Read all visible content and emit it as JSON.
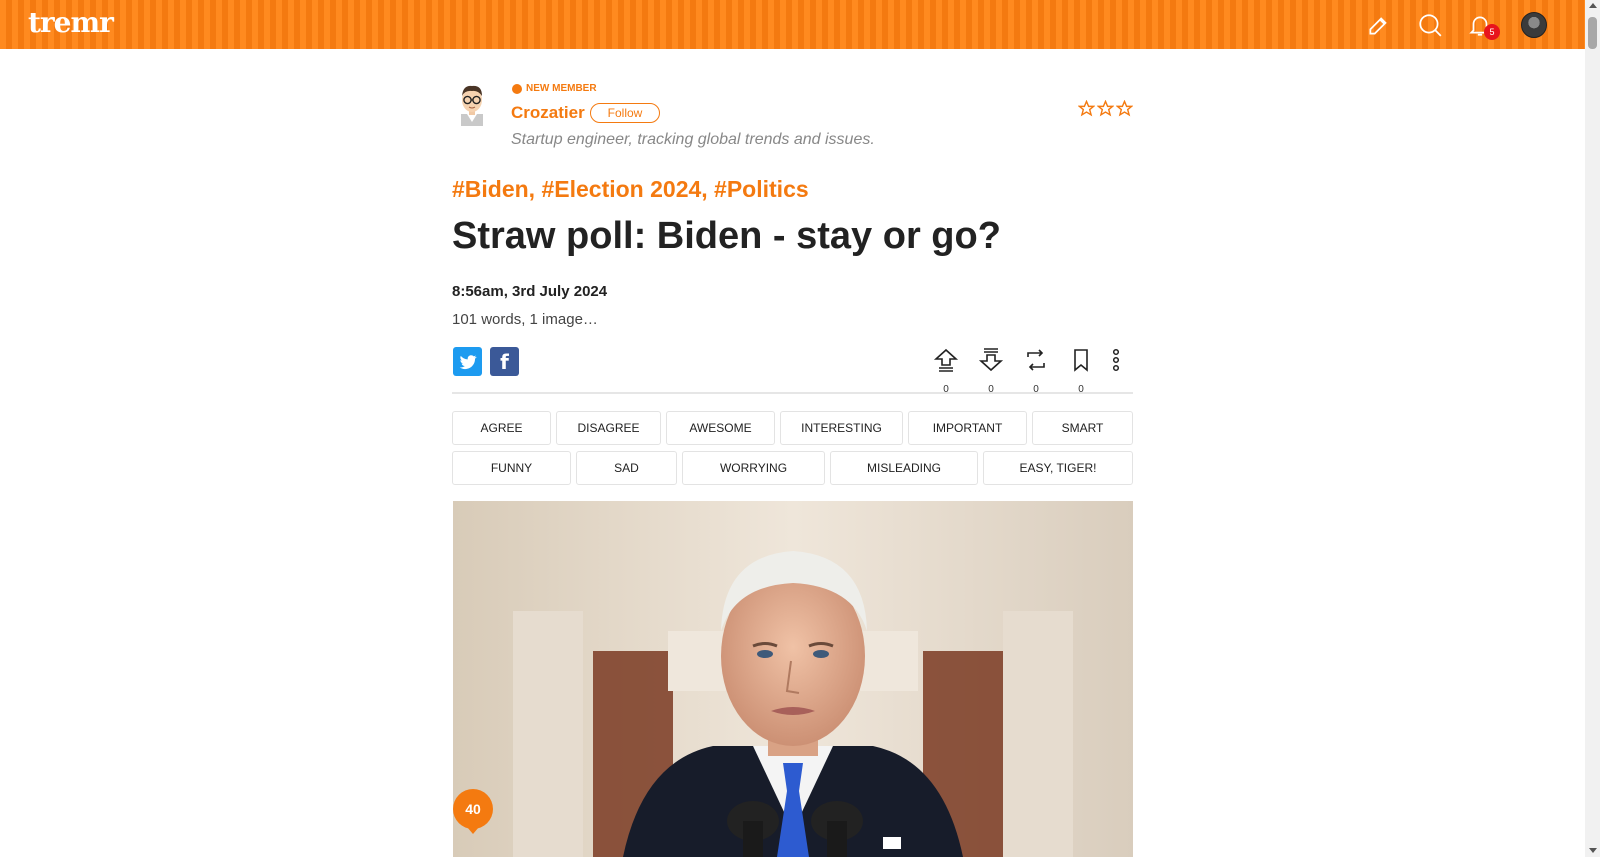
{
  "header": {
    "logo": "tremr",
    "notification_count": "5",
    "icons": [
      "edit-icon",
      "search-icon",
      "bell-icon",
      "user-avatar"
    ]
  },
  "author": {
    "badge": "NEW MEMBER",
    "name": "Crozatier",
    "follow_label": "Follow",
    "bio": "Startup engineer, tracking global trends and issues."
  },
  "post": {
    "tags": "#Biden, #Election 2024, #Politics",
    "title": "Straw poll: Biden - stay or go?",
    "date": "8:56am, 3rd July 2024",
    "meta": "101 words, 1 image…",
    "score": "40"
  },
  "actions": [
    {
      "name": "upvote",
      "count": "0"
    },
    {
      "name": "downvote",
      "count": "0"
    },
    {
      "name": "repost",
      "count": "0"
    },
    {
      "name": "bookmark",
      "count": "0"
    }
  ],
  "reactions_row1": [
    "AGREE",
    "DISAGREE",
    "AWESOME",
    "INTERESTING",
    "IMPORTANT",
    "SMART"
  ],
  "reactions_row2": [
    "FUNNY",
    "SAD",
    "WORRYING",
    "MISLEADING",
    "EASY, TIGER!"
  ],
  "colors": {
    "accent": "#f47a10",
    "twitter": "#1d9bf0",
    "facebook": "#3b5998",
    "badge_red": "#e8141c"
  }
}
